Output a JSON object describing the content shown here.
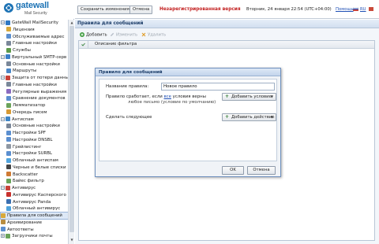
{
  "logo": {
    "word": "gatewall",
    "sub": "Mail Security"
  },
  "sidebar": {
    "items": [
      {
        "label": "GateWall MailSecurity",
        "level": 0,
        "toggle": "−",
        "icon": "app-icon",
        "color": "#2f78c4"
      },
      {
        "label": "Лицензия",
        "level": 1,
        "icon": "license-icon",
        "color": "#d8a93a"
      },
      {
        "label": "Обслуживаемые адрес",
        "level": 1,
        "icon": "address-icon",
        "color": "#5b8fd0"
      },
      {
        "label": "Главные настройки",
        "level": 1,
        "icon": "settings-icon",
        "color": "#7a8799"
      },
      {
        "label": "Службы",
        "level": 1,
        "icon": "services-icon",
        "color": "#5d9a4a"
      },
      {
        "label": "Виртуальный SMTP-серв",
        "level": 0,
        "toggle": "−",
        "icon": "smtp-icon",
        "color": "#3b7fc9"
      },
      {
        "label": "Основные настройки",
        "level": 1,
        "icon": "settings-icon",
        "color": "#7a8799"
      },
      {
        "label": "Маршруты",
        "level": 1,
        "icon": "routes-icon",
        "color": "#4a87c8"
      },
      {
        "label": "Защита от потери данных",
        "level": 0,
        "toggle": "−",
        "icon": "dlp-icon",
        "color": "#c9423a"
      },
      {
        "label": "Главные настройки",
        "level": 1,
        "icon": "settings-icon",
        "color": "#7a8799"
      },
      {
        "label": "Регулярные выражения",
        "level": 1,
        "icon": "regex-icon",
        "color": "#8a6bc0"
      },
      {
        "label": "Сравнение документов",
        "level": 1,
        "icon": "compare-icon",
        "color": "#5b8fd0"
      },
      {
        "label": "Лемматизатор",
        "level": 1,
        "icon": "lemma-icon",
        "color": "#6aa35a"
      },
      {
        "label": "Очередь писем",
        "level": 1,
        "icon": "queue-icon",
        "color": "#d89a34"
      },
      {
        "label": "Антиспам",
        "level": 0,
        "toggle": "−",
        "icon": "antispam-icon",
        "color": "#3f86c8"
      },
      {
        "label": "Основные настройки",
        "level": 1,
        "icon": "settings-icon",
        "color": "#7a8799"
      },
      {
        "label": "Настройки SPF",
        "level": 1,
        "icon": "spf-icon",
        "color": "#5b8fd0"
      },
      {
        "label": "Настройки DNSBL",
        "level": 1,
        "icon": "dnsbl-icon",
        "color": "#5b8fd0"
      },
      {
        "label": "Грейлистинг",
        "level": 1,
        "icon": "greylist-icon",
        "color": "#8e97a3"
      },
      {
        "label": "Настройки SURBL",
        "level": 1,
        "icon": "surbl-icon",
        "color": "#5b8fd0"
      },
      {
        "label": "Облачный антиспам",
        "level": 1,
        "icon": "cloud-icon",
        "color": "#4fa3dc"
      },
      {
        "label": "Черные и белые списки",
        "level": 1,
        "icon": "lists-icon",
        "color": "#444"
      },
      {
        "label": "Backscatter",
        "level": 1,
        "icon": "backscatter-icon",
        "color": "#d07b34"
      },
      {
        "label": "Байес фильтр",
        "level": 1,
        "icon": "bayes-icon",
        "color": "#6aa35a"
      },
      {
        "label": "Антивирус",
        "level": 0,
        "toggle": "−",
        "icon": "antivirus-icon",
        "color": "#c9423a"
      },
      {
        "label": "Антивирус Касперского",
        "level": 1,
        "icon": "kaspersky-icon",
        "color": "#c9302c"
      },
      {
        "label": "Антивирус Panda",
        "level": 1,
        "icon": "panda-icon",
        "color": "#3a6fb0"
      },
      {
        "label": "Облачный антивирус",
        "level": 1,
        "icon": "cloud-icon",
        "color": "#4fa3dc"
      },
      {
        "label": "Правила для сообщений",
        "level": 0,
        "icon": "rules-icon",
        "color": "#d8a93a",
        "selected": true
      },
      {
        "label": "Архивирование",
        "level": 0,
        "icon": "archive-icon",
        "color": "#b98d3f"
      },
      {
        "label": "Автоответы",
        "level": 0,
        "icon": "autoreply-icon",
        "color": "#5b8fd0"
      },
      {
        "label": "Загрузчики почты",
        "level": 0,
        "toggle": "+",
        "icon": "loader-icon",
        "color": "#6aa35a"
      }
    ]
  },
  "topbar": {
    "save_label": "Сохранить изменения",
    "cancel_label": "Отмена",
    "unregistered": "Незарегистрированная версия",
    "datetime": "Вторник, 24 января 22:54 (UTC+04:00)",
    "help": "Помощь",
    "lang_ru": "RU",
    "exit": "Выход"
  },
  "content": {
    "title": "Правила для сообщений",
    "toolbar": {
      "add": "Добавить",
      "edit": "Изменить",
      "delete": "Удалить"
    },
    "columns": {
      "description": "Описание фильтра"
    }
  },
  "modal": {
    "title": "Правило для сообщений",
    "name_label": "Название правила:",
    "name_value": "Новое правило",
    "trigger_prefix": "Правило сработает, если ",
    "trigger_link": "все",
    "trigger_suffix": " условия верны",
    "trigger_note": "любое письмо (условие по умолчанию)",
    "add_condition": "Добавить условие",
    "action_label": "Сделать следующее",
    "add_action": "Добавить действие",
    "ok": "OK",
    "cancel": "Отмена"
  },
  "colors": {
    "accent": "#1d73b5",
    "warning": "#c21f1f",
    "link": "#1e4fb5"
  }
}
